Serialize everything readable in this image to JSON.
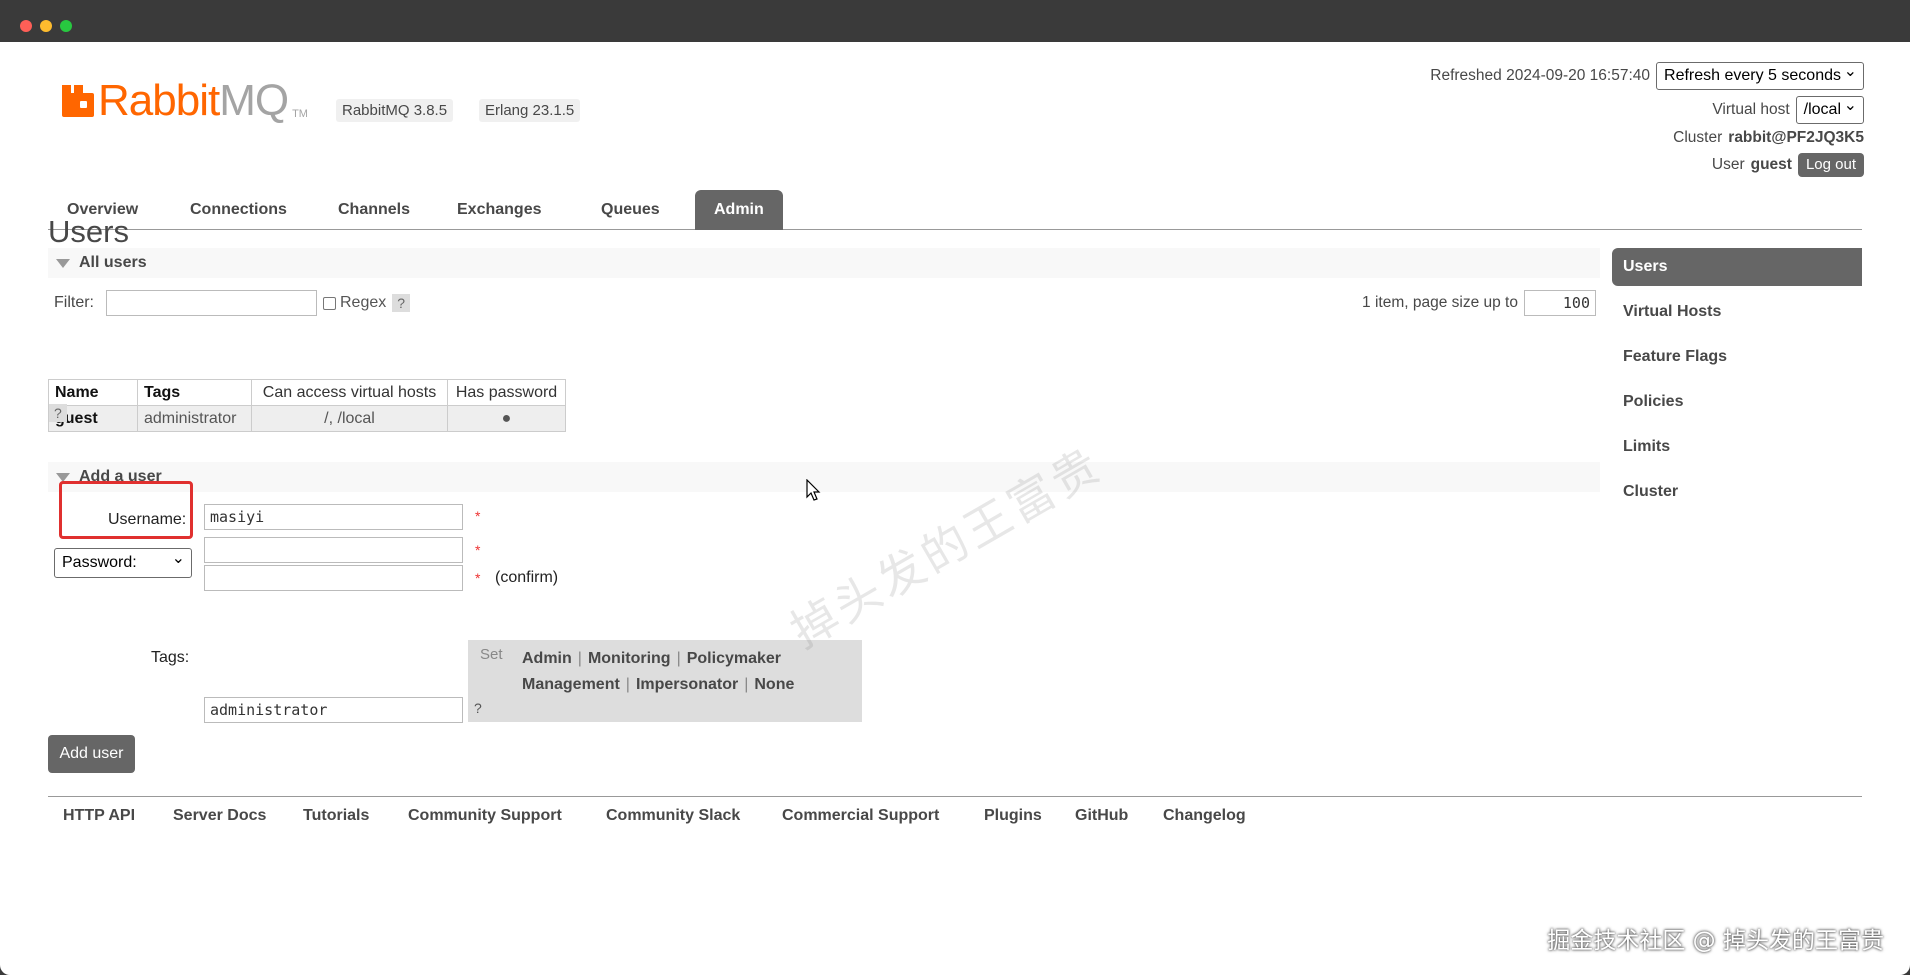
{
  "window": {
    "controls": [
      "close",
      "minimize",
      "maximize"
    ]
  },
  "header": {
    "logo": {
      "rabbit": "Rabbit",
      "mq": "MQ",
      "tm": "TM"
    },
    "rabbitmq_version": "RabbitMQ 3.8.5",
    "erlang_version": "Erlang 23.1.5",
    "refreshed": "Refreshed 2024-09-20 16:57:40",
    "refresh_select": "Refresh every 5 seconds",
    "vhost_label": "Virtual host",
    "vhost_select": "/local",
    "cluster_label": "Cluster",
    "cluster_name": "rabbit@PF2JQ3K5",
    "user_label": "User",
    "user_name": "guest",
    "logout": "Log out"
  },
  "tabs": [
    {
      "label": "Overview"
    },
    {
      "label": "Connections"
    },
    {
      "label": "Channels"
    },
    {
      "label": "Exchanges"
    },
    {
      "label": "Queues"
    },
    {
      "label": "Admin",
      "active": true
    }
  ],
  "page_title": "Users",
  "all_users": {
    "section_title": "All users",
    "filter_label": "Filter:",
    "filter_value": "",
    "regex_label": "Regex",
    "help": "?",
    "pager_text": "1 item, page size up to",
    "page_size": "100",
    "columns": [
      "Name",
      "Tags",
      "Can access virtual hosts",
      "Has password"
    ],
    "rows": [
      {
        "name": "guest",
        "tags": "administrator",
        "vhosts": "/, /local",
        "has_password": "●"
      }
    ],
    "table_help": "?"
  },
  "add_user": {
    "section_title": "Add a user",
    "username_label": "Username:",
    "username_value": "masiyi",
    "password_mode": "Password:",
    "password_value": "",
    "confirm_value": "",
    "required_mark": "*",
    "confirm_label": "(confirm)",
    "tags_label": "Tags:",
    "tags_value": "administrator",
    "tags_help": "?",
    "set_label": "Set",
    "tag_options": [
      "Admin",
      "Monitoring",
      "Policymaker",
      "Management",
      "Impersonator",
      "None"
    ],
    "separator": "|",
    "submit": "Add user"
  },
  "footer_links": [
    "HTTP API",
    "Server Docs",
    "Tutorials",
    "Community Support",
    "Community Slack",
    "Commercial Support",
    "Plugins",
    "GitHub",
    "Changelog"
  ],
  "sidebar": [
    {
      "label": "Users",
      "active": true
    },
    {
      "label": "Virtual Hosts"
    },
    {
      "label": "Feature Flags"
    },
    {
      "label": "Policies"
    },
    {
      "label": "Limits"
    },
    {
      "label": "Cluster"
    }
  ],
  "watermark": "掉头发的王富贵",
  "credit": "掘金技术社区 @ 掉头发的王富贵",
  "colors": {
    "brand_orange": "#ff6600",
    "tab_active": "#666666",
    "highlight_red": "#e0302f"
  }
}
